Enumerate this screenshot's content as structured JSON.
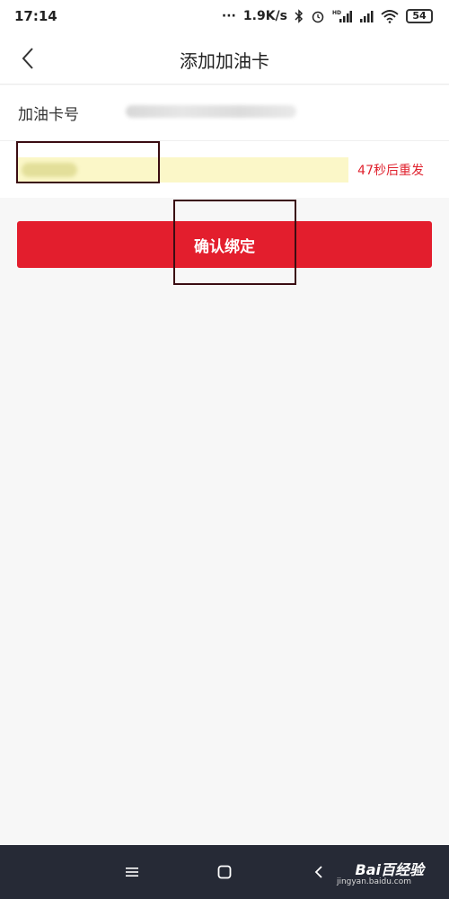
{
  "status_bar": {
    "time": "17:14",
    "speed": "1.9K/s",
    "battery": "54",
    "hd_label": "HD"
  },
  "header": {
    "title": "添加加油卡",
    "back_icon": "chevron-left-icon"
  },
  "form": {
    "card_label": "加油卡号",
    "resend_label": "47秒后重发"
  },
  "confirm_button": {
    "label": "确认绑定"
  },
  "nav_bar": {
    "watermark": "Bai百经验",
    "watermark_sub": "jingyan.baidu.com"
  },
  "colors": {
    "accent": "#e31e2d",
    "input_highlight": "#fbf7c8",
    "nav_bar": "#262a36"
  }
}
